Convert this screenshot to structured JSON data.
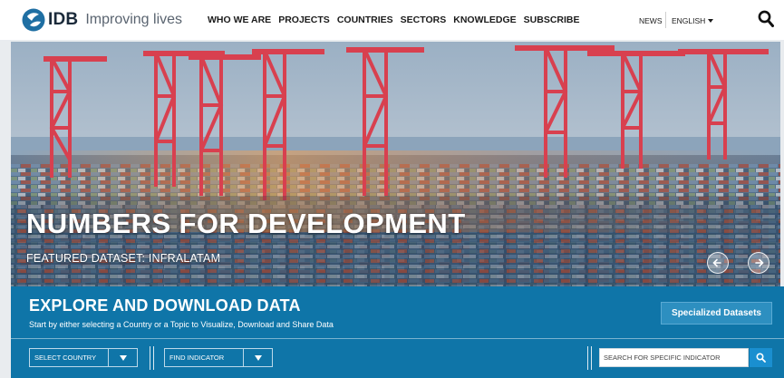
{
  "header": {
    "logo_text": "IDB",
    "tagline": "Improving lives",
    "nav": [
      "WHO WE ARE",
      "PROJECTS",
      "COUNTRIES",
      "SECTORS",
      "KNOWLEDGE",
      "SUBSCRIBE"
    ],
    "news_label": "NEWS",
    "language_label": "ENGLISH",
    "search_icon": "search-icon"
  },
  "hero": {
    "title": "NUMBERS FOR DEVELOPMENT",
    "subtitle": "FEATURED DATASET: INFRALATAM",
    "prev_icon": "chevron-left-icon",
    "next_icon": "chevron-right-icon"
  },
  "explore": {
    "title": "EXPLORE AND DOWNLOAD DATA",
    "subtitle": "Start by either selecting a Country or a Topic to Visualize, Download and Share Data",
    "specialized_button": "Specialized Datasets",
    "country_select": "SELECT COUNTRY",
    "indicator_select": "FIND INDICATOR",
    "search_placeholder": "SEARCH FOR SPECIFIC INDICATOR",
    "search_button_icon": "search-icon"
  },
  "colors": {
    "band": "#0f75a8",
    "button": "#2d8fc0",
    "search_button": "#1a8fd0",
    "crane": "#d8404f"
  }
}
